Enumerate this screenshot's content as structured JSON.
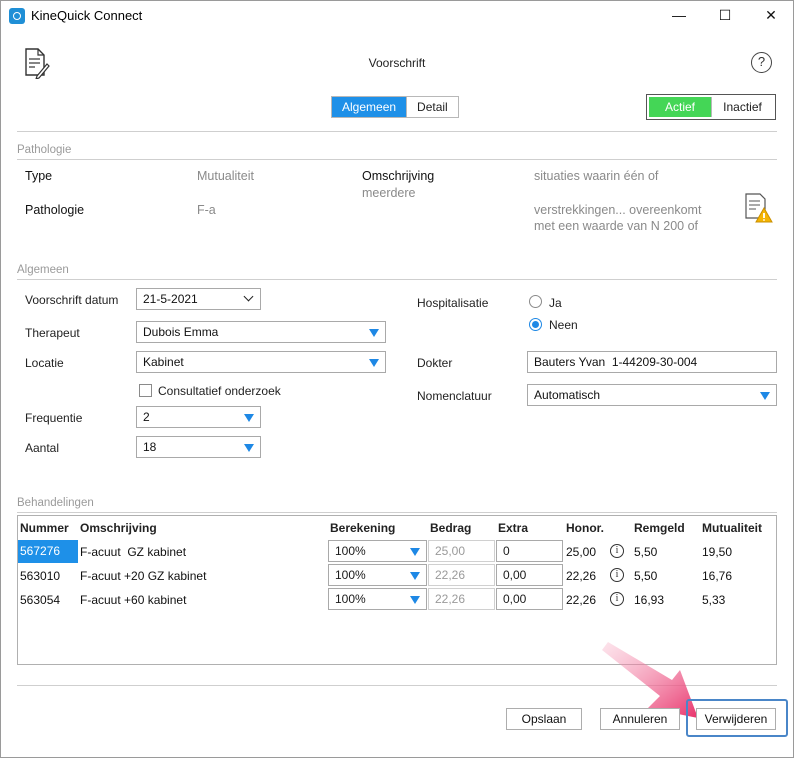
{
  "window": {
    "title": "KineQuick Connect",
    "minimize_glyph": "—",
    "maximize_glyph": "☐",
    "close_glyph": "✕"
  },
  "header": {
    "title": "Voorschrift",
    "help_glyph": "?",
    "tabs": [
      {
        "label": "Algemeen",
        "active": true
      },
      {
        "label": "Detail",
        "active": false
      }
    ],
    "status_toggle": [
      {
        "label": "Actief",
        "active": true
      },
      {
        "label": "Inactief",
        "active": false
      }
    ]
  },
  "pathologie": {
    "section_title": "Pathologie",
    "type_label": "Type",
    "type_value": "Mutualiteit",
    "pathologie_label": "Pathologie",
    "pathologie_value": "F-a",
    "omschrijving_label": "Omschrijving",
    "omschrijving_value_line1": "situaties waarin één of",
    "omschrijving_value_line2": "meerdere",
    "omschrijving_value_line3": "verstrekkingen... overeenkomt",
    "omschrijving_value_line4": "met een waarde van N 200 of"
  },
  "algemeen": {
    "section_title": "Algemeen",
    "voorschrift_datum_label": "Voorschrift datum",
    "voorschrift_datum_value": "21-5-2021",
    "therapeut_label": "Therapeut",
    "therapeut_value": "Dubois Emma",
    "locatie_label": "Locatie",
    "locatie_value": "Kabinet",
    "consultatief_label": "Consultatief onderzoek",
    "consultatief_checked": false,
    "frequentie_label": "Frequentie",
    "frequentie_value": "2",
    "aantal_label": "Aantal",
    "aantal_value": "18",
    "hospitalisatie_label": "Hospitalisatie",
    "hospitalisatie_options": [
      {
        "label": "Ja",
        "selected": false
      },
      {
        "label": "Neen",
        "selected": true
      }
    ],
    "dokter_label": "Dokter",
    "dokter_value": "Bauters Yvan  1-44209-30-004",
    "nomenclatuur_label": "Nomenclatuur",
    "nomenclatuur_value": "Automatisch"
  },
  "behandelingen": {
    "section_title": "Behandelingen",
    "columns": [
      "Nummer",
      "Omschrijving",
      "Berekening",
      "Bedrag",
      "Extra",
      "Honor.",
      "Remgeld",
      "Mutualiteit"
    ],
    "rows": [
      {
        "nummer": "567276",
        "omschrijving": "F-acuut  GZ kabinet",
        "berekening": "100%",
        "bedrag": "25,00",
        "extra": "0",
        "honor": "25,00",
        "remgeld": "5,50",
        "mutualiteit": "19,50",
        "selected": true
      },
      {
        "nummer": "563010",
        "omschrijving": "F-acuut +20 GZ kabinet",
        "berekening": "100%",
        "bedrag": "22,26",
        "extra": "0,00",
        "honor": "22,26",
        "remgeld": "5,50",
        "mutualiteit": "16,76",
        "selected": false
      },
      {
        "nummer": "563054",
        "omschrijving": "F-acuut +60 kabinet",
        "berekening": "100%",
        "bedrag": "22,26",
        "extra": "0,00",
        "honor": "22,26",
        "remgeld": "16,93",
        "mutualiteit": "5,33",
        "selected": false
      }
    ]
  },
  "footer": {
    "opslaan": "Opslaan",
    "annuleren": "Annuleren",
    "verwijderen": "Verwijderen"
  },
  "colors": {
    "accent_blue": "#1e90e8",
    "active_green": "#44d656",
    "arrow_pink": "#e8336b"
  }
}
